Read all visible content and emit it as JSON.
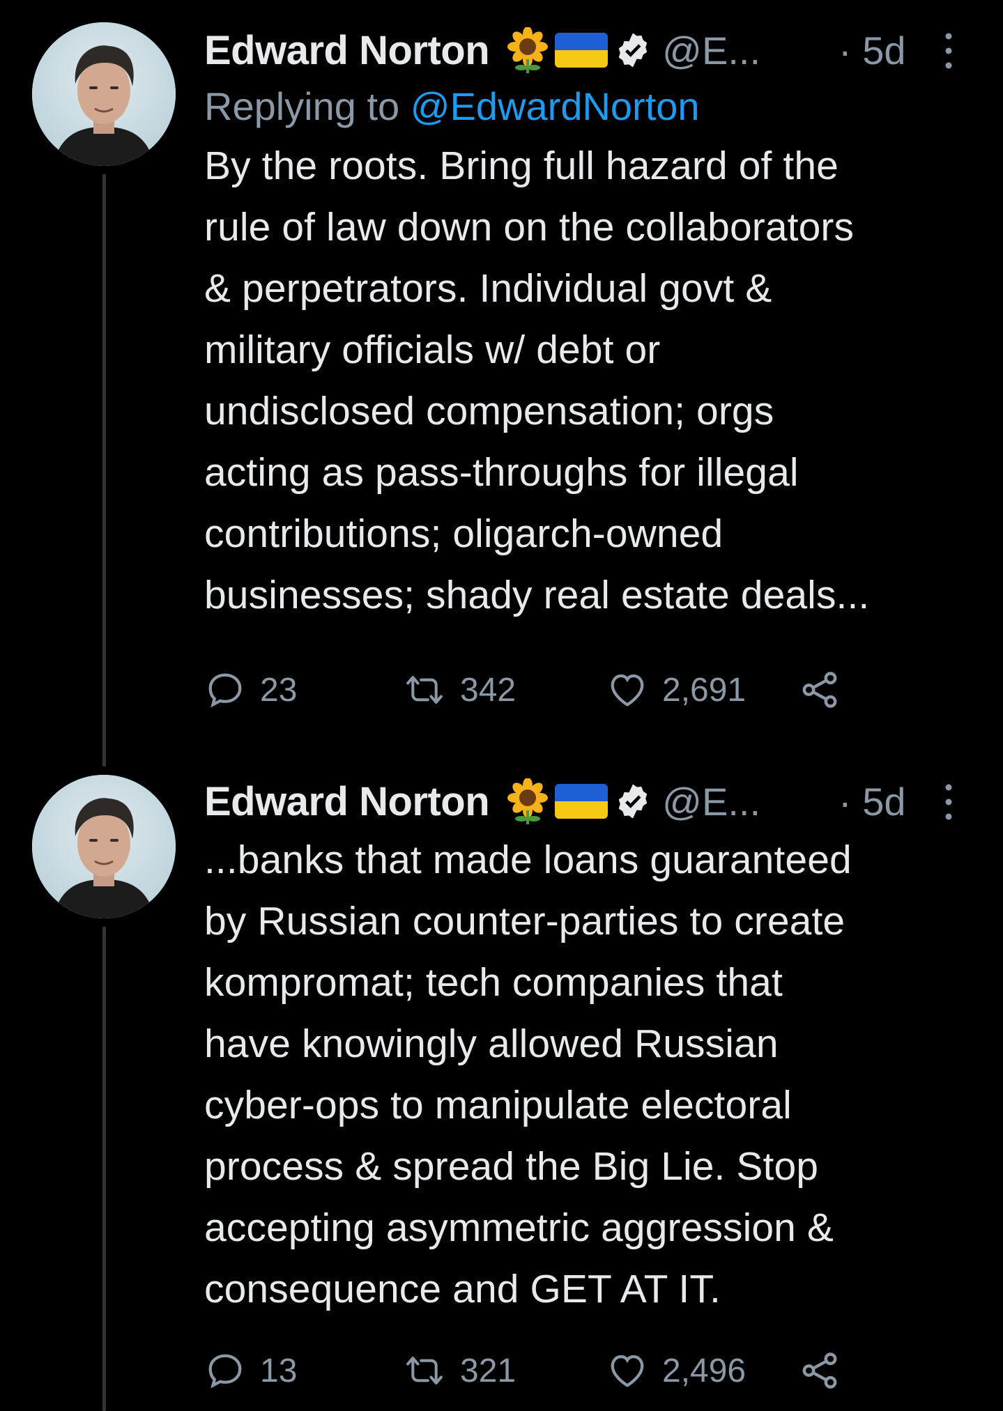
{
  "colors": {
    "background": "#000000",
    "text": "#e7e9ea",
    "secondary": "#8b98a5",
    "link": "#1d9bf0",
    "thread_line": "#333639",
    "flag_blue": "#1f5fd6",
    "flag_yellow": "#f6c915"
  },
  "tweets": [
    {
      "author": {
        "name": "Edward Norton",
        "emoji_icons": [
          "sunflower-icon",
          "ukraine-flag-icon"
        ],
        "verified": true,
        "handle": "@E...",
        "time": "· 5d"
      },
      "replying_prefix": "Replying to ",
      "replying_to": "@EdwardNorton",
      "text": "By the roots. Bring full hazard of the\nrule of law down on the collaborators\n& perpetrators. Individual govt &\nmilitary officials w/ debt or\nundisclosed compensation; orgs\nacting as pass-throughs for illegal\ncontributions; oligarch-owned\nbusinesses; shady real estate deals...",
      "stats": {
        "replies": "23",
        "retweets": "342",
        "likes": "2,691"
      }
    },
    {
      "author": {
        "name": "Edward Norton",
        "emoji_icons": [
          "sunflower-icon",
          "ukraine-flag-icon"
        ],
        "verified": true,
        "handle": "@E...",
        "time": "· 5d"
      },
      "text": "...banks that made loans guaranteed\nby Russian counter-parties to create\nkompromat; tech companies that\nhave knowingly allowed Russian\ncyber-ops to manipulate electoral\nprocess & spread the Big Lie. Stop\naccepting asymmetric aggression &\nconsequence and GET AT IT.",
      "stats": {
        "replies": "13",
        "retweets": "321",
        "likes": "2,496"
      }
    }
  ]
}
